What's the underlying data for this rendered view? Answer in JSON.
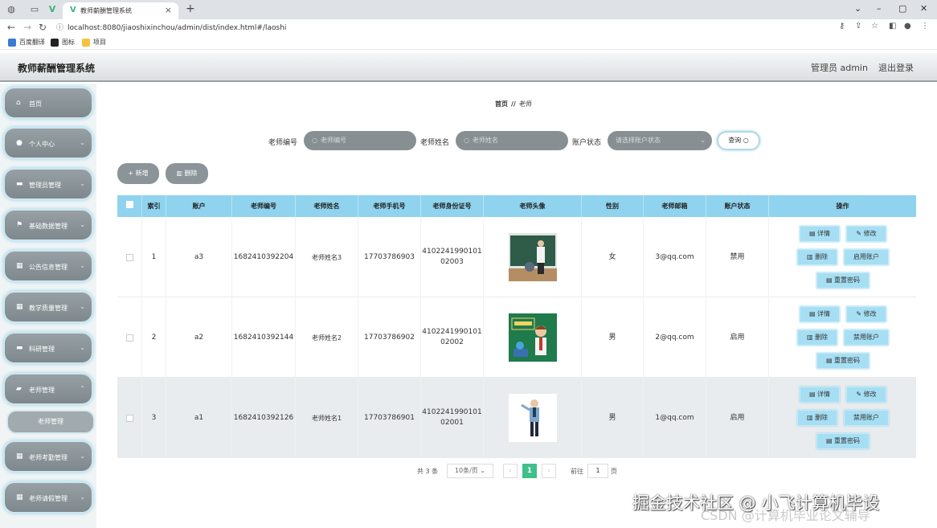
{
  "browser": {
    "tab_title": "教师薪酬管理系统",
    "url": "localhost:8080/jiaoshixinchou/admin/dist/index.html#/laoshi",
    "bookmarks": [
      "百度翻译",
      "图标",
      "项目"
    ]
  },
  "header": {
    "app_title": "教师薪酬管理系统",
    "admin_label": "管理员 admin",
    "logout_label": "退出登录"
  },
  "sidebar": {
    "items": [
      {
        "label": "首页",
        "icon": "home-icon"
      },
      {
        "label": "个人中心",
        "icon": "user-icon"
      },
      {
        "label": "管理员管理",
        "icon": "chat-icon"
      },
      {
        "label": "基础数据管理",
        "icon": "flag-icon"
      },
      {
        "label": "公告信息管理",
        "icon": "grid-icon"
      },
      {
        "label": "教学质量管理",
        "icon": "grid-icon"
      },
      {
        "label": "科研管理",
        "icon": "chat-icon"
      },
      {
        "label": "老师管理",
        "icon": "folder-icon"
      },
      {
        "label": "老师考勤管理",
        "icon": "grid-icon"
      },
      {
        "label": "老师请假管理",
        "icon": "grid-icon"
      }
    ],
    "submenu_label": "老师管理"
  },
  "breadcrumb": {
    "home": "首页",
    "separator": "//",
    "current": "老师"
  },
  "search": {
    "teacher_no_label": "老师编号",
    "teacher_no_placeholder": "老师编号",
    "teacher_name_label": "老师姓名",
    "teacher_name_placeholder": "老师姓名",
    "status_label": "账户状态",
    "status_placeholder": "请选择账户状态",
    "query_label": "查询"
  },
  "actions": {
    "add_label": "+ 新增",
    "delete_label": "删除"
  },
  "table": {
    "headers": [
      "索引",
      "账户",
      "老师编号",
      "老师姓名",
      "老师手机号",
      "老师身份证号",
      "老师头像",
      "性别",
      "老师邮箱",
      "账户状态",
      "操作"
    ],
    "rows": [
      {
        "index": "1",
        "account": "a3",
        "teacher_no": "1682410392204",
        "name": "老师姓名3",
        "phone": "17703786903",
        "id_card_1": "4102241990101",
        "id_card_2": "02003",
        "gender": "女",
        "email": "3@qq.com",
        "status": "禁用",
        "toggle_label": "启用账户"
      },
      {
        "index": "2",
        "account": "a2",
        "teacher_no": "1682410392144",
        "name": "老师姓名2",
        "phone": "17703786902",
        "id_card_1": "4102241990101",
        "id_card_2": "02002",
        "gender": "男",
        "email": "2@qq.com",
        "status": "启用",
        "toggle_label": "禁用账户"
      },
      {
        "index": "3",
        "account": "a1",
        "teacher_no": "1682410392126",
        "name": "老师姓名1",
        "phone": "17703786901",
        "id_card_1": "4102241990101",
        "id_card_2": "02001",
        "gender": "男",
        "email": "1@qq.com",
        "status": "启用",
        "toggle_label": "禁用账户"
      }
    ],
    "ops": {
      "detail": "详情",
      "edit": "修改",
      "delete": "删除",
      "reset": "重置密码"
    }
  },
  "pagination": {
    "total": "共 3 条",
    "page_size": "10条/页",
    "current_page": "1",
    "goto_label": "前往",
    "goto_value": "1",
    "page_unit": "页"
  },
  "watermark": {
    "line1": "掘金技术社区 @ 小飞计算机毕设",
    "line2": "CSDN @计算机毕业论文辅导"
  },
  "colors": {
    "accent": "#8fd3ee",
    "sidebar_pill": "#878f93",
    "pager_active": "#3fc08a"
  }
}
